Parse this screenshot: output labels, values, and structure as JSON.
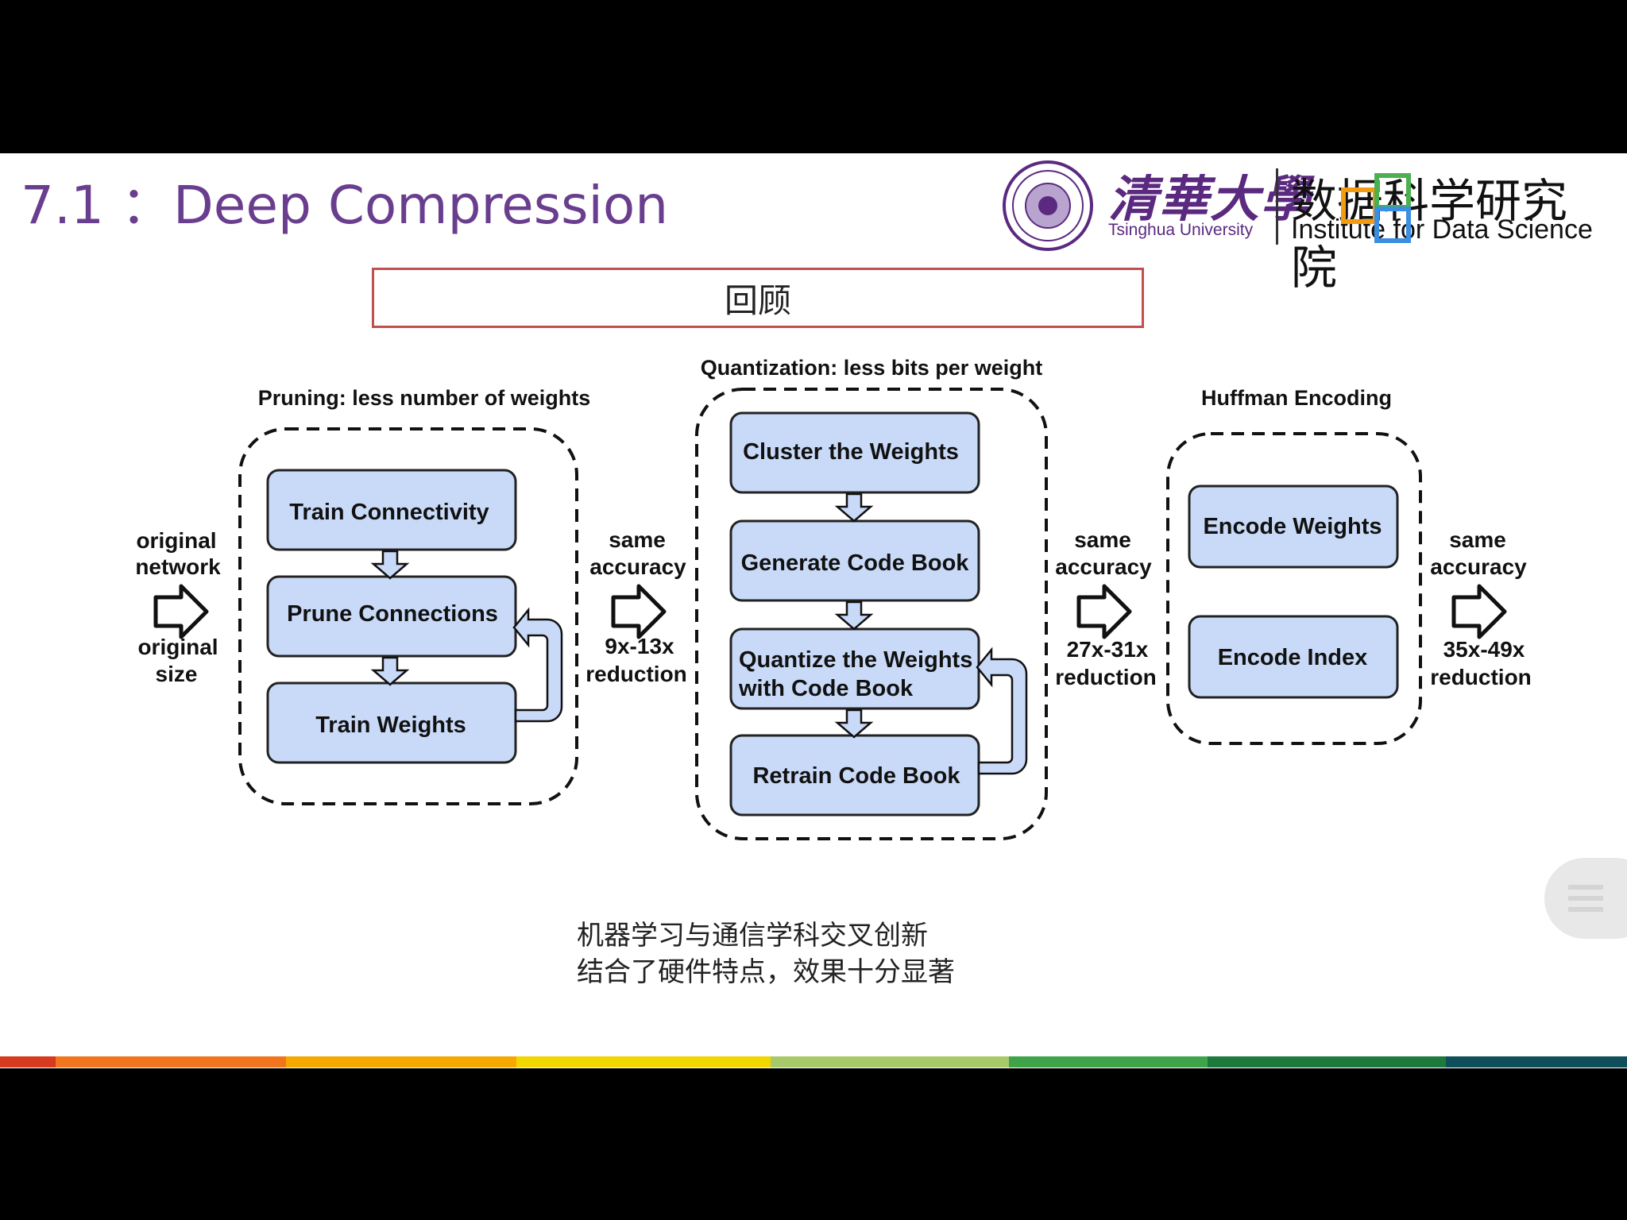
{
  "slide": {
    "title": "7.1 ：Deep Compression",
    "review_label": "回顾",
    "logo": {
      "university_cn": "清華大學",
      "university_en": "Tsinghua University",
      "institute_cn": "数据科学研究院",
      "institute_en": "Institute for Data Science"
    },
    "diagram": {
      "pruning": {
        "heading": "Pruning: less number of weights",
        "steps": [
          "Train Connectivity",
          "Prune Connections",
          "Train Weights"
        ]
      },
      "quantization": {
        "heading": "Quantization: less bits per weight",
        "steps": [
          "Cluster the Weights",
          "Generate Code Book",
          "Quantize the Weights",
          "with Code Book",
          "Retrain Code Book"
        ]
      },
      "huffman": {
        "heading": "Huffman Encoding",
        "steps": [
          "Encode Weights",
          "Encode Index"
        ]
      },
      "input_top": [
        "original",
        "network"
      ],
      "input_bottom": [
        "original",
        "size"
      ],
      "stage1_top": [
        "same",
        "accuracy"
      ],
      "stage1_bottom": [
        "9x-13x",
        "reduction"
      ],
      "stage2_top": [
        "same",
        "accuracy"
      ],
      "stage2_bottom": [
        "27x-31x",
        "reduction"
      ],
      "stage3_top": [
        "same",
        "accuracy"
      ],
      "stage3_bottom": [
        "35x-49x",
        "reduction"
      ]
    },
    "footer_lines": [
      "机器学习与通信学科交叉创新",
      "结合了硬件特点，效果十分显著"
    ]
  },
  "colors": {
    "title": "#6a3e8f",
    "box_fill": "#c9daf8",
    "review_border": "#c0504d"
  }
}
